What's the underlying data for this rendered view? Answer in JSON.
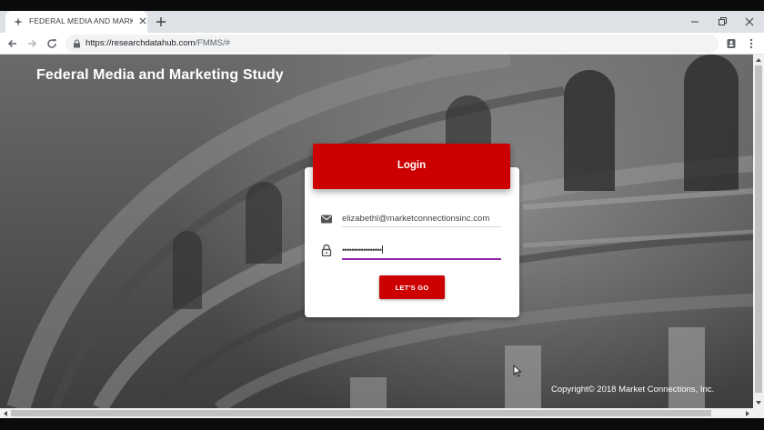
{
  "browser": {
    "tab_title": "FEDERAL MEDIA AND MARKETING",
    "url_host": "https://researchdatahub.com",
    "url_path": "/FMMS/#"
  },
  "page": {
    "site_title": "Federal Media and Marketing Study",
    "login": {
      "header": "Login",
      "email_value": "elizabethl@marketconnectionsinc.com",
      "password_mask": "•••••••••••••••••",
      "submit_label": "LET'S GO"
    },
    "copyright": "Copyright© 2018 Market Connections, Inc."
  },
  "colors": {
    "accent": "#cc0000",
    "focus_underline": "#8e24aa"
  },
  "icons": [
    "tab-favicon-icon",
    "close-icon",
    "plus-icon",
    "minimize-icon",
    "restore-icon",
    "back-icon",
    "forward-icon",
    "reload-icon",
    "lock-icon",
    "profile-icon",
    "more-icon",
    "mail-icon",
    "padlock-icon"
  ]
}
